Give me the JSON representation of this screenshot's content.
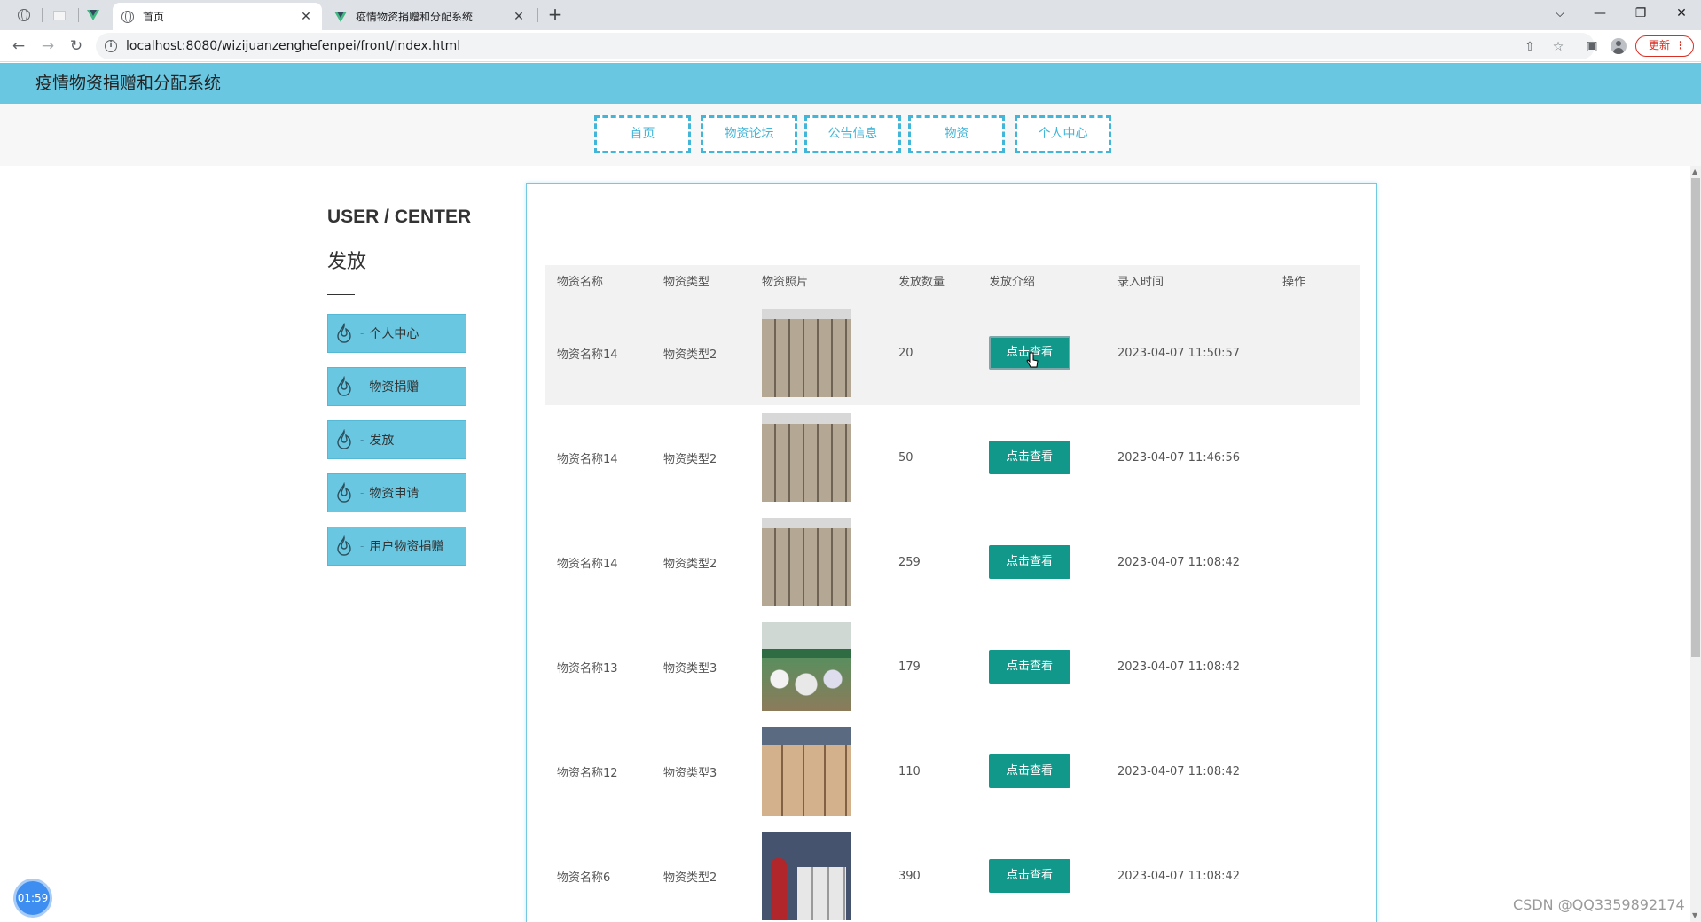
{
  "browser": {
    "tabs": [
      {
        "title": "首页",
        "icon": "globe-icon",
        "active": true
      },
      {
        "title": "疫情物资捐赠和分配系统",
        "icon": "vue-icon",
        "active": false
      }
    ],
    "close_glyph": "✕",
    "new_tab_glyph": "+",
    "url": "localhost:8080/wizijuanzenghefenpei/front/index.html",
    "update_label": "更新",
    "window_controls": {
      "dropdown": "⌵",
      "minimize": "—",
      "restore": "❐",
      "close": "✕"
    }
  },
  "site": {
    "title": "疫情物资捐赠和分配系统",
    "nav": [
      "首页",
      "物资论坛",
      "公告信息",
      "物资",
      "个人中心"
    ],
    "accent": "#6ac7e1",
    "button_color": "#11988a"
  },
  "sidebar": {
    "title": "USER / CENTER",
    "subtitle": "发放",
    "dash": "-",
    "items": [
      "个人中心",
      "物资捐赠",
      "发放",
      "物资申请",
      "用户物资捐赠"
    ]
  },
  "table": {
    "columns": [
      "物资名称",
      "物资类型",
      "物资照片",
      "发放数量",
      "发放介绍",
      "录入时间",
      "操作"
    ],
    "view_label": "点击查看",
    "rows": [
      {
        "name": "物资名称14",
        "type": "物资类型2",
        "photo": "boxes",
        "qty": "20",
        "time": "2023-04-07 11:50:57"
      },
      {
        "name": "物资名称14",
        "type": "物资类型2",
        "photo": "boxes",
        "qty": "50",
        "time": "2023-04-07 11:46:56"
      },
      {
        "name": "物资名称14",
        "type": "物资类型2",
        "photo": "boxes",
        "qty": "259",
        "time": "2023-04-07 11:08:42"
      },
      {
        "name": "物资名称13",
        "type": "物资类型3",
        "photo": "bottles",
        "qty": "179",
        "time": "2023-04-07 11:08:42"
      },
      {
        "name": "物资名称12",
        "type": "物资类型3",
        "photo": "cartons",
        "qty": "110",
        "time": "2023-04-07 11:08:42"
      },
      {
        "name": "物资名称6",
        "type": "物资类型2",
        "photo": "workers",
        "qty": "390",
        "time": "2023-04-07 11:08:42"
      }
    ]
  },
  "overlay": {
    "timer": "01:59",
    "watermark": "CSDN @QQ3359892174"
  }
}
